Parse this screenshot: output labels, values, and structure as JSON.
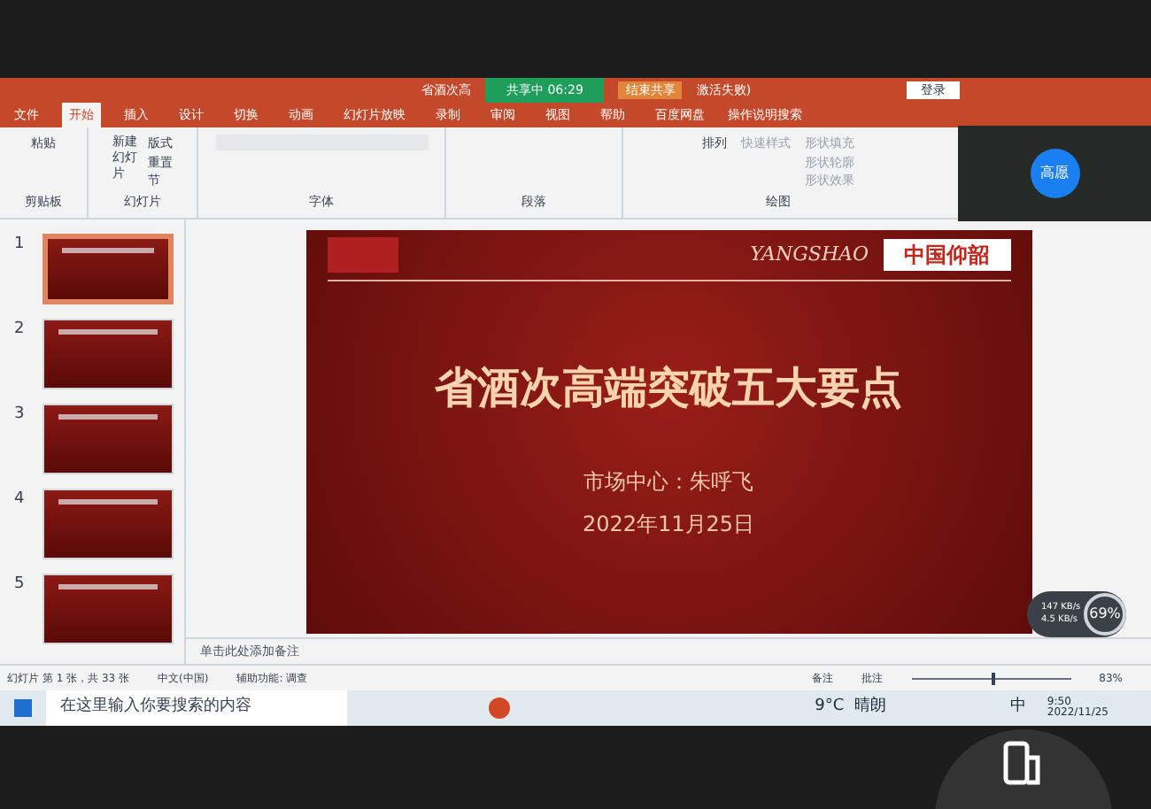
{
  "window": {
    "title_left": "省酒次高",
    "title_right": "激活失败)",
    "share_status": "共享中 06:29",
    "end_share": "结束共享",
    "login": "登录"
  },
  "tabs": [
    {
      "label": "文件",
      "selected": false
    },
    {
      "label": "开始",
      "selected": true
    },
    {
      "label": "插入",
      "selected": false
    },
    {
      "label": "设计",
      "selected": false
    },
    {
      "label": "切换",
      "selected": false
    },
    {
      "label": "动画",
      "selected": false
    },
    {
      "label": "幻灯片放映",
      "selected": false
    },
    {
      "label": "录制",
      "selected": false
    },
    {
      "label": "审阅",
      "selected": false
    },
    {
      "label": "视图",
      "selected": false
    },
    {
      "label": "帮助",
      "selected": false
    },
    {
      "label": "百度网盘",
      "selected": false
    }
  ],
  "tell_me": "操作说明搜索",
  "ribbon": {
    "paste": "粘贴",
    "clipboard": "剪贴板",
    "new_slide": "新建幻灯片",
    "layout": "版式",
    "reset": "重置",
    "section": "节",
    "slides": "幻灯片",
    "font": "字体",
    "paragraph": "段落",
    "arrange": "排列",
    "quick_styles": "快速样式",
    "shape_fill": "形状填充",
    "shape_outline": "形状轮廓",
    "shape_effects": "形状效果",
    "drawing": "绘图"
  },
  "thumbnails": [
    {
      "number": "1",
      "selected": true
    },
    {
      "number": "2",
      "selected": false
    },
    {
      "number": "3",
      "selected": false
    },
    {
      "number": "4",
      "selected": false
    },
    {
      "number": "5",
      "selected": false
    }
  ],
  "slide": {
    "brand": "YANGSHAO",
    "brand_cn": "中国仰韶",
    "title": "省酒次高端突破五大要点",
    "presenter": "市场中心：朱呼飞",
    "date": "2022年11月25日"
  },
  "notes_placeholder": "单击此处添加备注",
  "status_bar": {
    "slide_count": "幻灯片 第 1 张，共 33 张",
    "language": "中文(中国)",
    "accessibility": "辅助功能: 调查",
    "notes": "备注",
    "comments": "批注",
    "zoom": "83%",
    "level": 0.5
  },
  "taskbar": {
    "search_placeholder": "在这里输入你要搜索的内容",
    "weather": "9°C  晴朗",
    "ime": "中",
    "time": "9:50",
    "date": "2022/11/25"
  },
  "participant": {
    "name": "高愿"
  },
  "network": {
    "upload": "147 KB/s",
    "download": "4.5 KB/s",
    "percent": "69%"
  }
}
